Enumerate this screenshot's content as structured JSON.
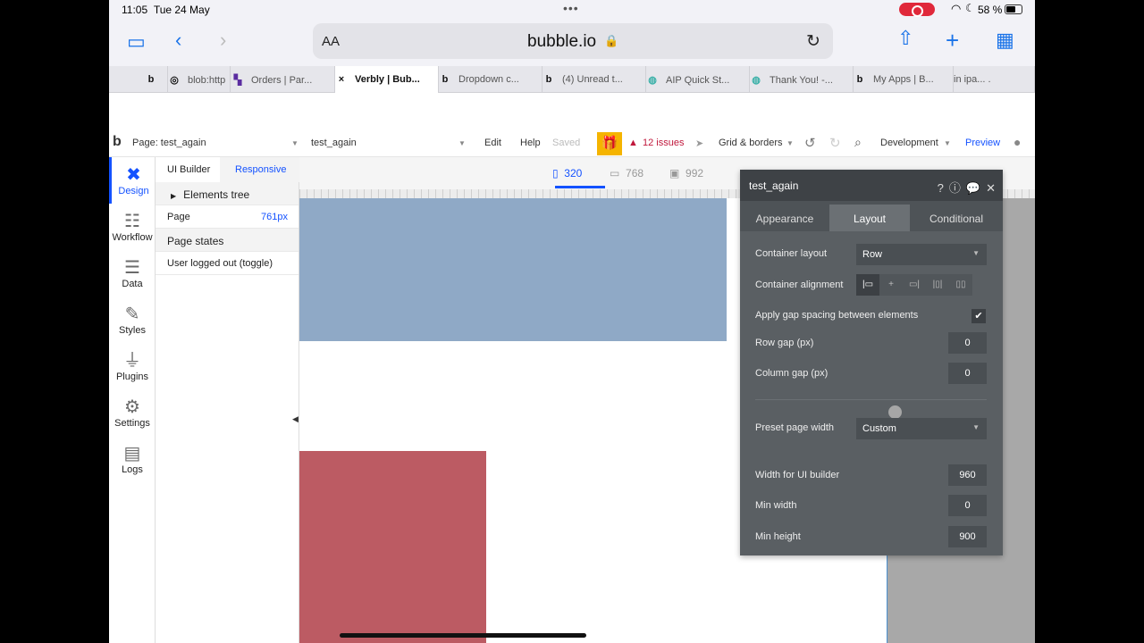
{
  "status": {
    "time": "11:05",
    "date": "Tue 24 May",
    "battery": "58 %"
  },
  "browser": {
    "aa_label": "AA",
    "host": "bubble.io",
    "tabs": [
      {
        "icon": "b",
        "label": ""
      },
      {
        "icon": "◎",
        "label": "blob:http"
      },
      {
        "icon": "▚",
        "label": "Orders | Par..."
      },
      {
        "icon": "×",
        "label": "Verbly | Bub..."
      },
      {
        "icon": "b",
        "label": "Dropdown c..."
      },
      {
        "icon": "b",
        "label": "(4) Unread t..."
      },
      {
        "icon": "◍",
        "label": "AIP Quick St..."
      },
      {
        "icon": "◍",
        "label": "Thank You! -..."
      },
      {
        "icon": "b",
        "label": "My Apps | B..."
      },
      {
        "icon": "",
        "label": "in ipa..."
      }
    ]
  },
  "header": {
    "page_select": "Page: test_again",
    "page_name": "test_again",
    "edit": "Edit",
    "help": "Help",
    "saved": "Saved",
    "issues": "12 issues",
    "grid": "Grid & borders",
    "env": "Development",
    "preview": "Preview"
  },
  "nav": {
    "design": "Design",
    "workflow": "Workflow",
    "data": "Data",
    "styles": "Styles",
    "plugins": "Plugins",
    "settings": "Settings",
    "logs": "Logs"
  },
  "panel": {
    "tab_ui": "UI Builder",
    "tab_responsive": "Responsive",
    "elements_tree": "Elements tree",
    "page_label": "Page",
    "page_value": "761px",
    "page_states": "Page states",
    "state_item": "User logged out (toggle)"
  },
  "canvas": {
    "size_320": "320",
    "size_768": "768",
    "size_992": "992"
  },
  "editor": {
    "title": "test_again",
    "tabs": [
      "Appearance",
      "Layout",
      "Conditional"
    ],
    "container_layout_label": "Container layout",
    "container_layout_value": "Row",
    "container_alignment_label": "Container alignment",
    "gap_label": "Apply gap spacing between elements",
    "row_gap_label": "Row gap (px)",
    "row_gap_value": "0",
    "col_gap_label": "Column gap (px)",
    "col_gap_value": "0",
    "preset_label": "Preset page width",
    "preset_value": "Custom",
    "width_ui_label": "Width for UI builder",
    "width_ui_value": "960",
    "min_width_label": "Min width",
    "min_width_value": "0",
    "min_height_label": "Min height",
    "min_height_value": "900"
  }
}
